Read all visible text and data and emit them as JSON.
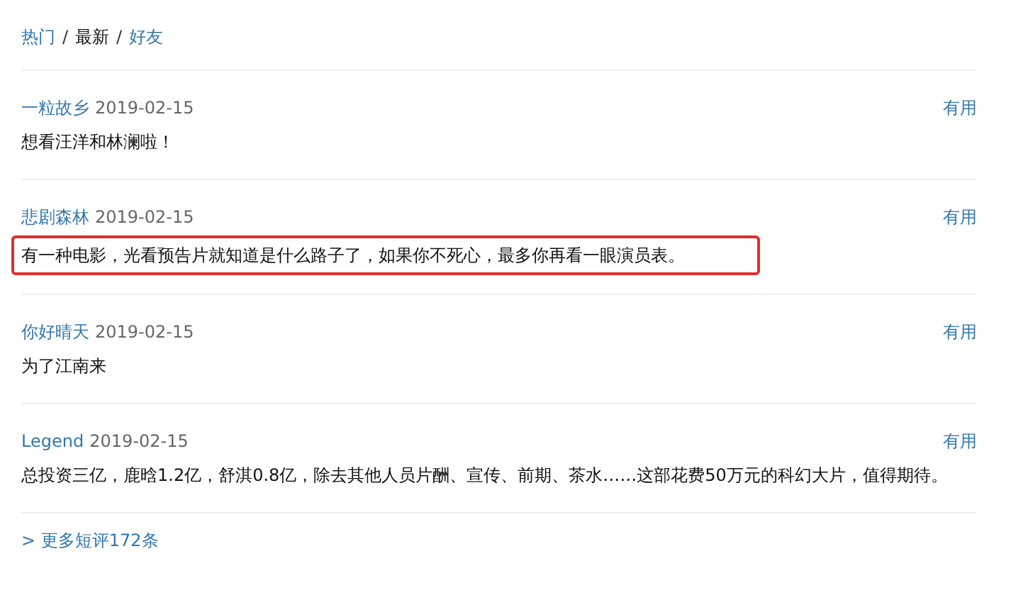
{
  "tabs": [
    {
      "label": "热门",
      "selected": false,
      "separator": "/"
    },
    {
      "label": "最新",
      "selected": true,
      "separator": "/"
    },
    {
      "label": "好友",
      "selected": false
    }
  ],
  "comments": [
    {
      "author": "一粒故乡",
      "date": "2019-02-15",
      "vote": "有用",
      "text": "想看汪洋和林澜啦！",
      "highlighted": false
    },
    {
      "author": "悲剧森林",
      "date": "2019-02-15",
      "vote": "有用",
      "text": "有一种电影，光看预告片就知道是什么路子了，如果你不死心，最多你再看一眼演员表。",
      "highlighted": true
    },
    {
      "author": "你好晴天",
      "date": "2019-02-15",
      "vote": "有用",
      "text": "为了江南来",
      "highlighted": false
    },
    {
      "author": "Legend",
      "date": "2019-02-15",
      "vote": "有用",
      "text": "总投资三亿，鹿晗1.2亿，舒淇0.8亿，除去其他人员片酬、宣传、前期、茶水……这部花费50万元的科幻大片，值得期待。",
      "highlighted": false
    }
  ],
  "more_link": "> 更多短评172条"
}
